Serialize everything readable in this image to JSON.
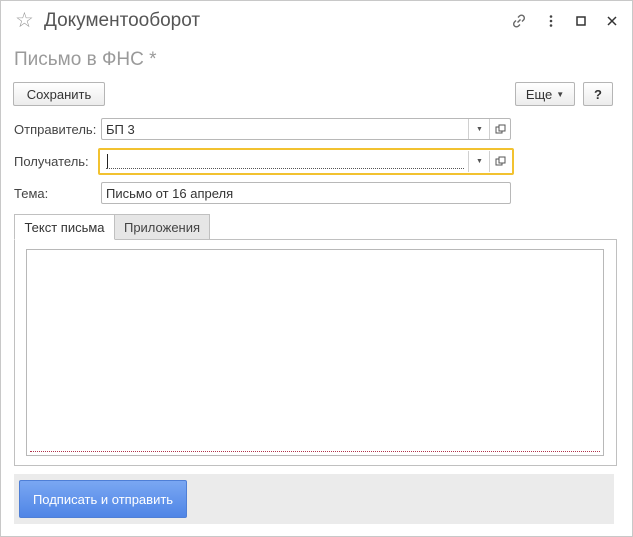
{
  "app": {
    "title": "Документооборот"
  },
  "form": {
    "title": "Письмо в ФНС *"
  },
  "toolbar": {
    "save_label": "Сохранить",
    "more_label": "Еще",
    "help_label": "?"
  },
  "fields": {
    "sender": {
      "label": "Отправитель:",
      "value": "БП 3"
    },
    "recipient": {
      "label": "Получатель:",
      "value": ""
    },
    "subject": {
      "label": "Тема:",
      "value": "Письмо от 16 апреля"
    }
  },
  "tabs": [
    {
      "label": "Текст письма",
      "active": true
    },
    {
      "label": "Приложения",
      "active": false
    }
  ],
  "footer": {
    "submit_label": "Подписать и отправить"
  },
  "colors": {
    "focus": "#f2c230",
    "primary": "#5b8ee8",
    "footer_bg": "#ebebeb"
  },
  "icons": [
    "star-icon",
    "link-icon",
    "kebab-menu-icon",
    "maximize-icon",
    "close-icon",
    "chevron-down-icon",
    "open-icon"
  ]
}
